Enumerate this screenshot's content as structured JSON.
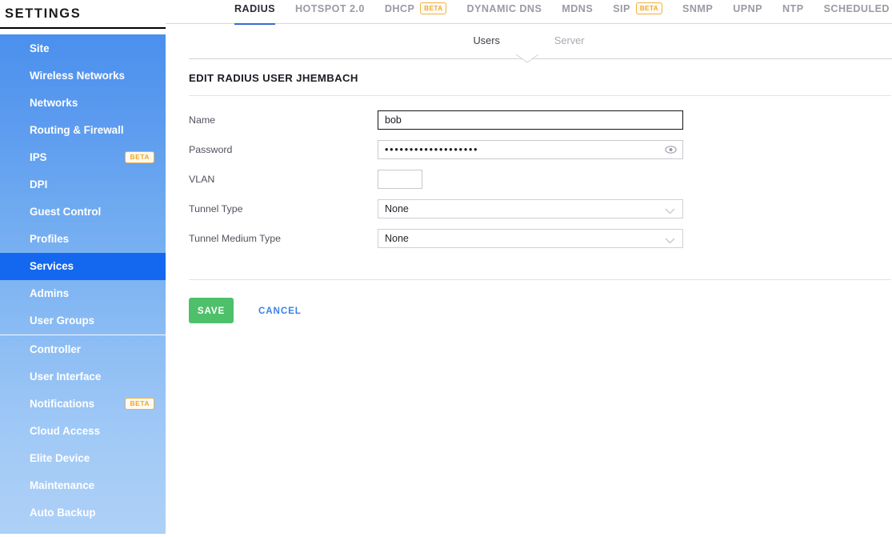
{
  "sidebar": {
    "title": "SETTINGS",
    "groups": [
      {
        "items": [
          {
            "label": "Site",
            "badge": null,
            "active": false
          },
          {
            "label": "Wireless Networks",
            "badge": null,
            "active": false
          },
          {
            "label": "Networks",
            "badge": null,
            "active": false
          },
          {
            "label": "Routing & Firewall",
            "badge": null,
            "active": false
          },
          {
            "label": "IPS",
            "badge": "BETA",
            "active": false
          },
          {
            "label": "DPI",
            "badge": null,
            "active": false
          },
          {
            "label": "Guest Control",
            "badge": null,
            "active": false
          },
          {
            "label": "Profiles",
            "badge": null,
            "active": false
          },
          {
            "label": "Services",
            "badge": null,
            "active": true
          },
          {
            "label": "Admins",
            "badge": null,
            "active": false
          },
          {
            "label": "User Groups",
            "badge": null,
            "active": false
          }
        ]
      },
      {
        "items": [
          {
            "label": "Controller",
            "badge": null,
            "active": false
          },
          {
            "label": "User Interface",
            "badge": null,
            "active": false
          },
          {
            "label": "Notifications",
            "badge": "BETA",
            "active": false
          },
          {
            "label": "Cloud Access",
            "badge": null,
            "active": false
          },
          {
            "label": "Elite Device",
            "badge": null,
            "active": false
          },
          {
            "label": "Maintenance",
            "badge": null,
            "active": false
          },
          {
            "label": "Auto Backup",
            "badge": null,
            "active": false
          }
        ]
      }
    ]
  },
  "tabs": [
    {
      "label": "RADIUS",
      "badge": null,
      "active": true
    },
    {
      "label": "HOTSPOT 2.0",
      "badge": null,
      "active": false
    },
    {
      "label": "DHCP",
      "badge": "BETA",
      "active": false
    },
    {
      "label": "DYNAMIC DNS",
      "badge": null,
      "active": false
    },
    {
      "label": "MDNS",
      "badge": null,
      "active": false
    },
    {
      "label": "SIP",
      "badge": "BETA",
      "active": false
    },
    {
      "label": "SNMP",
      "badge": null,
      "active": false
    },
    {
      "label": "UPNP",
      "badge": null,
      "active": false
    },
    {
      "label": "NTP",
      "badge": null,
      "active": false
    },
    {
      "label": "SCHEDULED UPGRADES",
      "badge": null,
      "active": false
    }
  ],
  "subtabs": [
    {
      "label": "Users",
      "active": true
    },
    {
      "label": "Server",
      "active": false
    }
  ],
  "form": {
    "heading": "EDIT RADIUS USER JHEMBACH",
    "fields": {
      "name": {
        "label": "Name",
        "value": "bob",
        "placeholder": ""
      },
      "password": {
        "label": "Password",
        "value": "•••••••••••••••••••",
        "placeholder": ""
      },
      "vlan": {
        "label": "VLAN",
        "value": "",
        "placeholder": ""
      },
      "tunnel_type": {
        "label": "Tunnel Type",
        "value": "None"
      },
      "tunnel_medium_type": {
        "label": "Tunnel Medium Type",
        "value": "None"
      }
    },
    "actions": {
      "save": "SAVE",
      "cancel": "CANCEL"
    }
  },
  "colors": {
    "accent_blue": "#2f6fd1",
    "active_nav": "#1368ef",
    "save_green": "#4ec06a",
    "link_blue": "#3b82e8",
    "beta_orange": "#f5a623"
  }
}
